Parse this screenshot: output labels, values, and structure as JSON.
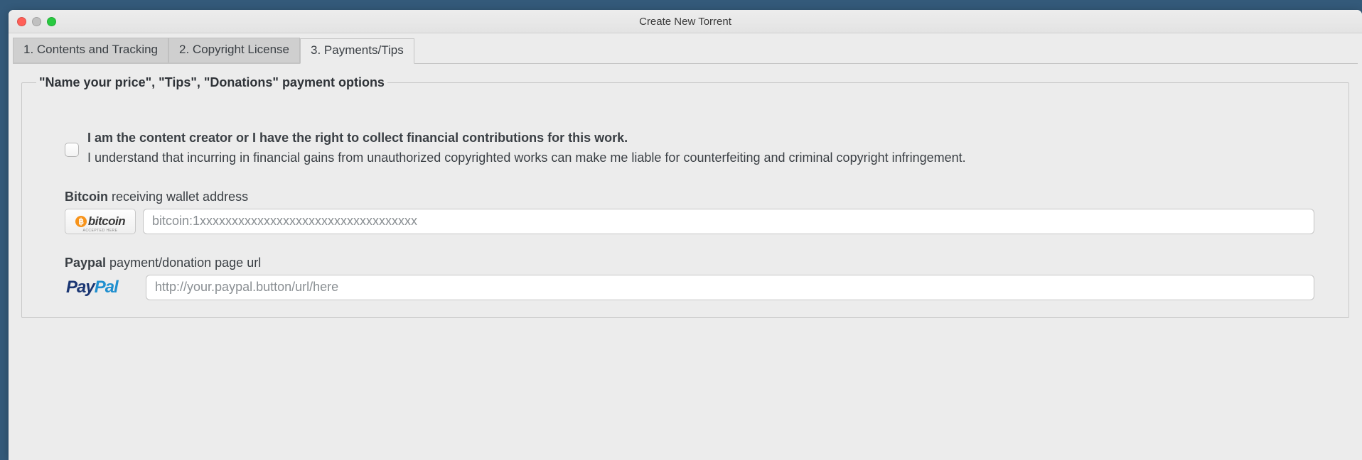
{
  "window": {
    "title": "Create New Torrent"
  },
  "tabs": [
    {
      "label": "1. Contents and Tracking",
      "active": false
    },
    {
      "label": "2. Copyright License",
      "active": false
    },
    {
      "label": "3. Payments/Tips",
      "active": true
    }
  ],
  "panel": {
    "legend": "\"Name your price\", \"Tips\", \"Donations\" payment options",
    "affirmation": {
      "bold_line": "I am the content creator or I have the right to collect financial contributions for this work.",
      "rest": "I understand that incurring in financial gains from unauthorized copyrighted works can make me liable for counterfeiting and criminal copyright infringement.",
      "checked": false
    },
    "bitcoin": {
      "label_strong": "Bitcoin",
      "label_rest": " receiving wallet address",
      "badge_text": "bitcoin",
      "badge_subtext": "ACCEPTED HERE",
      "placeholder": "bitcoin:1xxxxxxxxxxxxxxxxxxxxxxxxxxxxxxxxxx",
      "value": ""
    },
    "paypal": {
      "label_strong": "Paypal",
      "label_rest": " payment/donation page url",
      "badge_pay": "Pay",
      "badge_pal": "Pal",
      "placeholder": "http://your.paypal.button/url/here",
      "value": ""
    }
  }
}
